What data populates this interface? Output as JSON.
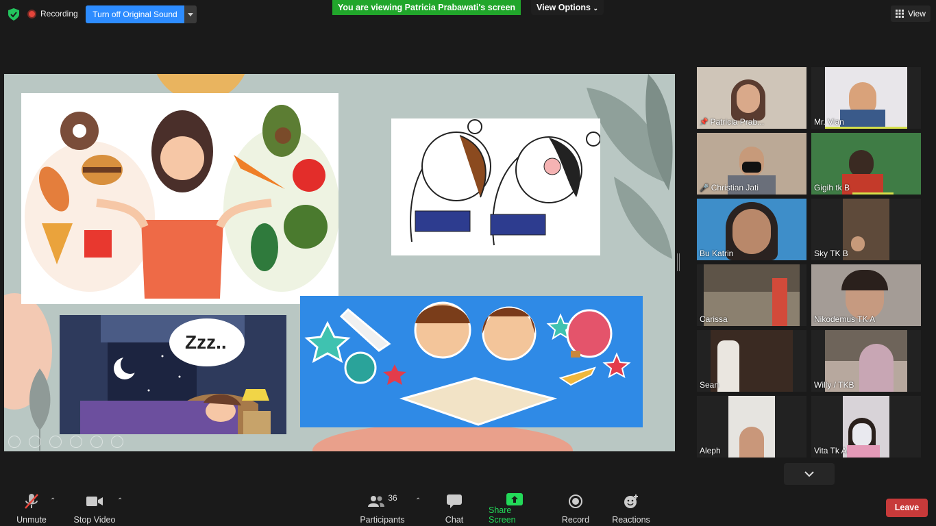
{
  "top_bar": {
    "recording_label": "Recording",
    "original_sound_button": "Turn off Original Sound",
    "viewing_banner": "You are viewing Patricia Prabawati's screen",
    "view_options": "View Options",
    "view_button": "View"
  },
  "gallery": [
    {
      "name": "Patricia Prab...",
      "icon": "pin-icon",
      "active": true
    },
    {
      "name": "Mr. Vian"
    },
    {
      "name": "Christian Jati",
      "icon": "mic-muted-icon"
    },
    {
      "name": "Gigih tk B"
    },
    {
      "name": "Bu Katrin"
    },
    {
      "name": "Sky TK B"
    },
    {
      "name": "Carissa"
    },
    {
      "name": "Nikodemus TK A"
    },
    {
      "name": "Sean"
    },
    {
      "name": "Willy / TKB"
    },
    {
      "name": "Aleph"
    },
    {
      "name": "Vita Tk A"
    }
  ],
  "slide": {
    "sleep_text": "Zzz.."
  },
  "toolbar": {
    "unmute": "Unmute",
    "stop_video": "Stop Video",
    "participants": "Participants",
    "participants_count": "36",
    "chat": "Chat",
    "share_screen": "Share Screen",
    "record": "Record",
    "reactions": "Reactions",
    "leave": "Leave"
  },
  "colors": {
    "accent_blue": "#2d8cff",
    "banner_green": "#21a62b",
    "share_green": "#23d959",
    "leave_red": "#c73a3a",
    "active_speaker": "#d6e04a"
  }
}
